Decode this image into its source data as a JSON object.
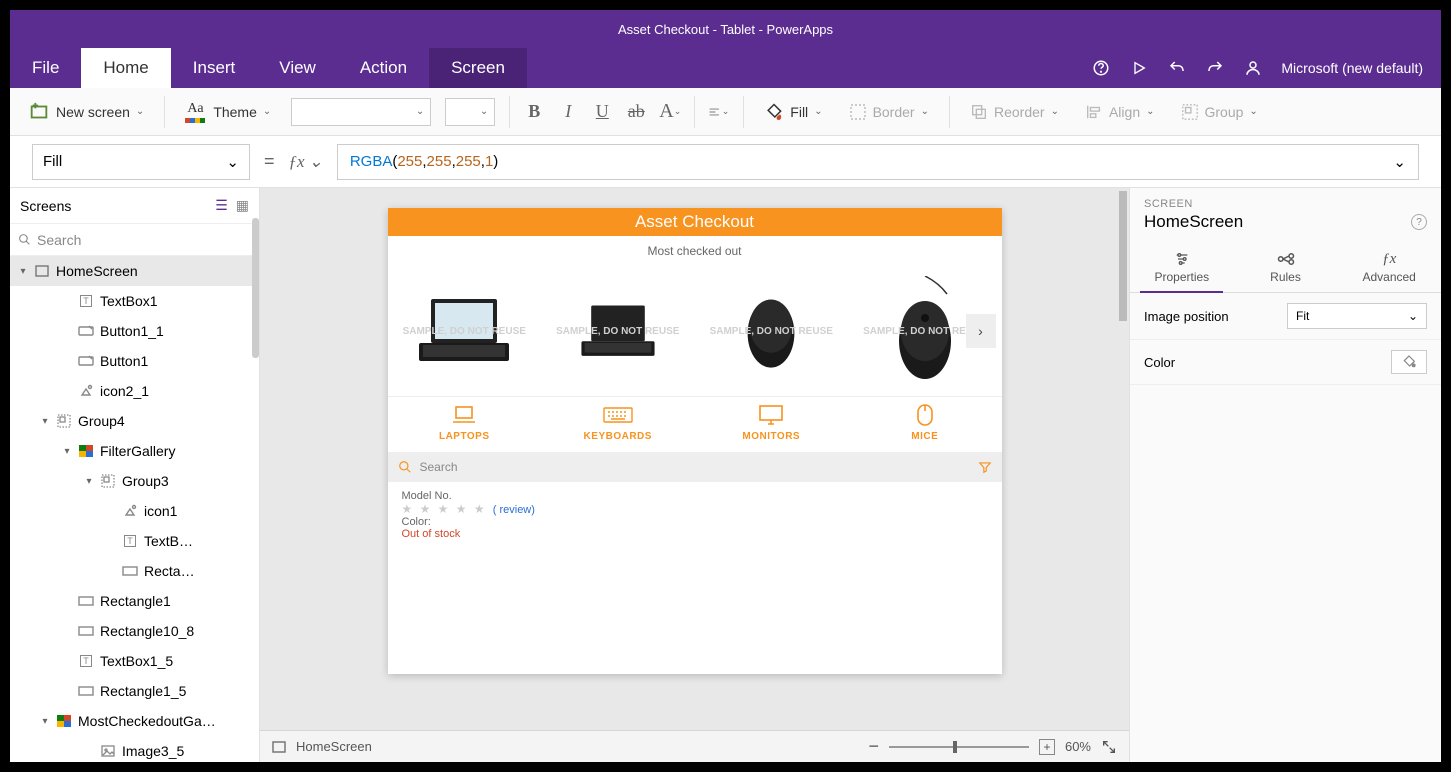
{
  "window_title": "Asset Checkout - Tablet - PowerApps",
  "menu": {
    "file": "File",
    "home": "Home",
    "insert": "Insert",
    "view": "View",
    "action": "Action",
    "screen": "Screen"
  },
  "header_right": {
    "account": "Microsoft (new default)"
  },
  "ribbon": {
    "new_screen": "New screen",
    "theme": "Theme",
    "fill": "Fill",
    "border": "Border",
    "reorder": "Reorder",
    "align": "Align",
    "group": "Group"
  },
  "formula": {
    "property": "Fill",
    "expr_prefix": "RGBA",
    "expr_args": [
      "255",
      "255",
      "255",
      "1"
    ]
  },
  "tree": {
    "title": "Screens",
    "search_placeholder": "Search",
    "items": [
      {
        "l": 0,
        "caret": "▾",
        "icon": "screen-icon",
        "text": "HomeScreen",
        "sel": true
      },
      {
        "l": 2,
        "icon": "text-icon",
        "text": "TextBox1"
      },
      {
        "l": 2,
        "icon": "button-icon",
        "text": "Button1_1"
      },
      {
        "l": 2,
        "icon": "button-icon",
        "text": "Button1"
      },
      {
        "l": 2,
        "icon": "icon-icon",
        "text": "icon2_1"
      },
      {
        "l": 1,
        "caret": "▾",
        "icon": "group-icon",
        "text": "Group4"
      },
      {
        "l": 2,
        "caret": "▾",
        "icon": "gallery-icon",
        "text": "FilterGallery"
      },
      {
        "l": 3,
        "caret": "▾",
        "icon": "group-icon",
        "text": "Group3"
      },
      {
        "l": 4,
        "icon": "icon-icon",
        "text": "icon1"
      },
      {
        "l": 4,
        "icon": "text-icon",
        "text": "TextB…"
      },
      {
        "l": 4,
        "icon": "rect-icon",
        "text": "Recta…"
      },
      {
        "l": 2,
        "icon": "rect-icon",
        "text": "Rectangle1"
      },
      {
        "l": 2,
        "icon": "rect-icon",
        "text": "Rectangle10_8"
      },
      {
        "l": 2,
        "icon": "text-icon",
        "text": "TextBox1_5"
      },
      {
        "l": 2,
        "icon": "rect-icon",
        "text": "Rectangle1_5"
      },
      {
        "l": 1,
        "caret": "▾",
        "icon": "gallery-icon",
        "text": "MostCheckedoutGa…"
      },
      {
        "l": 3,
        "icon": "image-icon",
        "text": "Image3_5"
      }
    ]
  },
  "canvas": {
    "title": "Asset Checkout",
    "subtitle": "Most checked out",
    "watermark": "SAMPLE,\nDO NOT REUSE",
    "categories": [
      {
        "label": "LAPTOPS",
        "icon": "laptop-icon"
      },
      {
        "label": "KEYBOARDS",
        "icon": "keyboard-icon"
      },
      {
        "label": "MONITORS",
        "icon": "monitor-icon"
      },
      {
        "label": "MICE",
        "icon": "mouse-icon"
      }
    ],
    "search_placeholder": "Search",
    "detail": {
      "model_label": "Model No.",
      "review_link": "( review)",
      "color_label": "Color:",
      "stock": "Out of stock"
    }
  },
  "status": {
    "breadcrumb": "HomeScreen",
    "zoom": "60%"
  },
  "props": {
    "section": "SCREEN",
    "name": "HomeScreen",
    "tabs": {
      "properties": "Properties",
      "rules": "Rules",
      "advanced": "Advanced"
    },
    "image_position_label": "Image position",
    "image_position_value": "Fit",
    "color_label": "Color"
  }
}
